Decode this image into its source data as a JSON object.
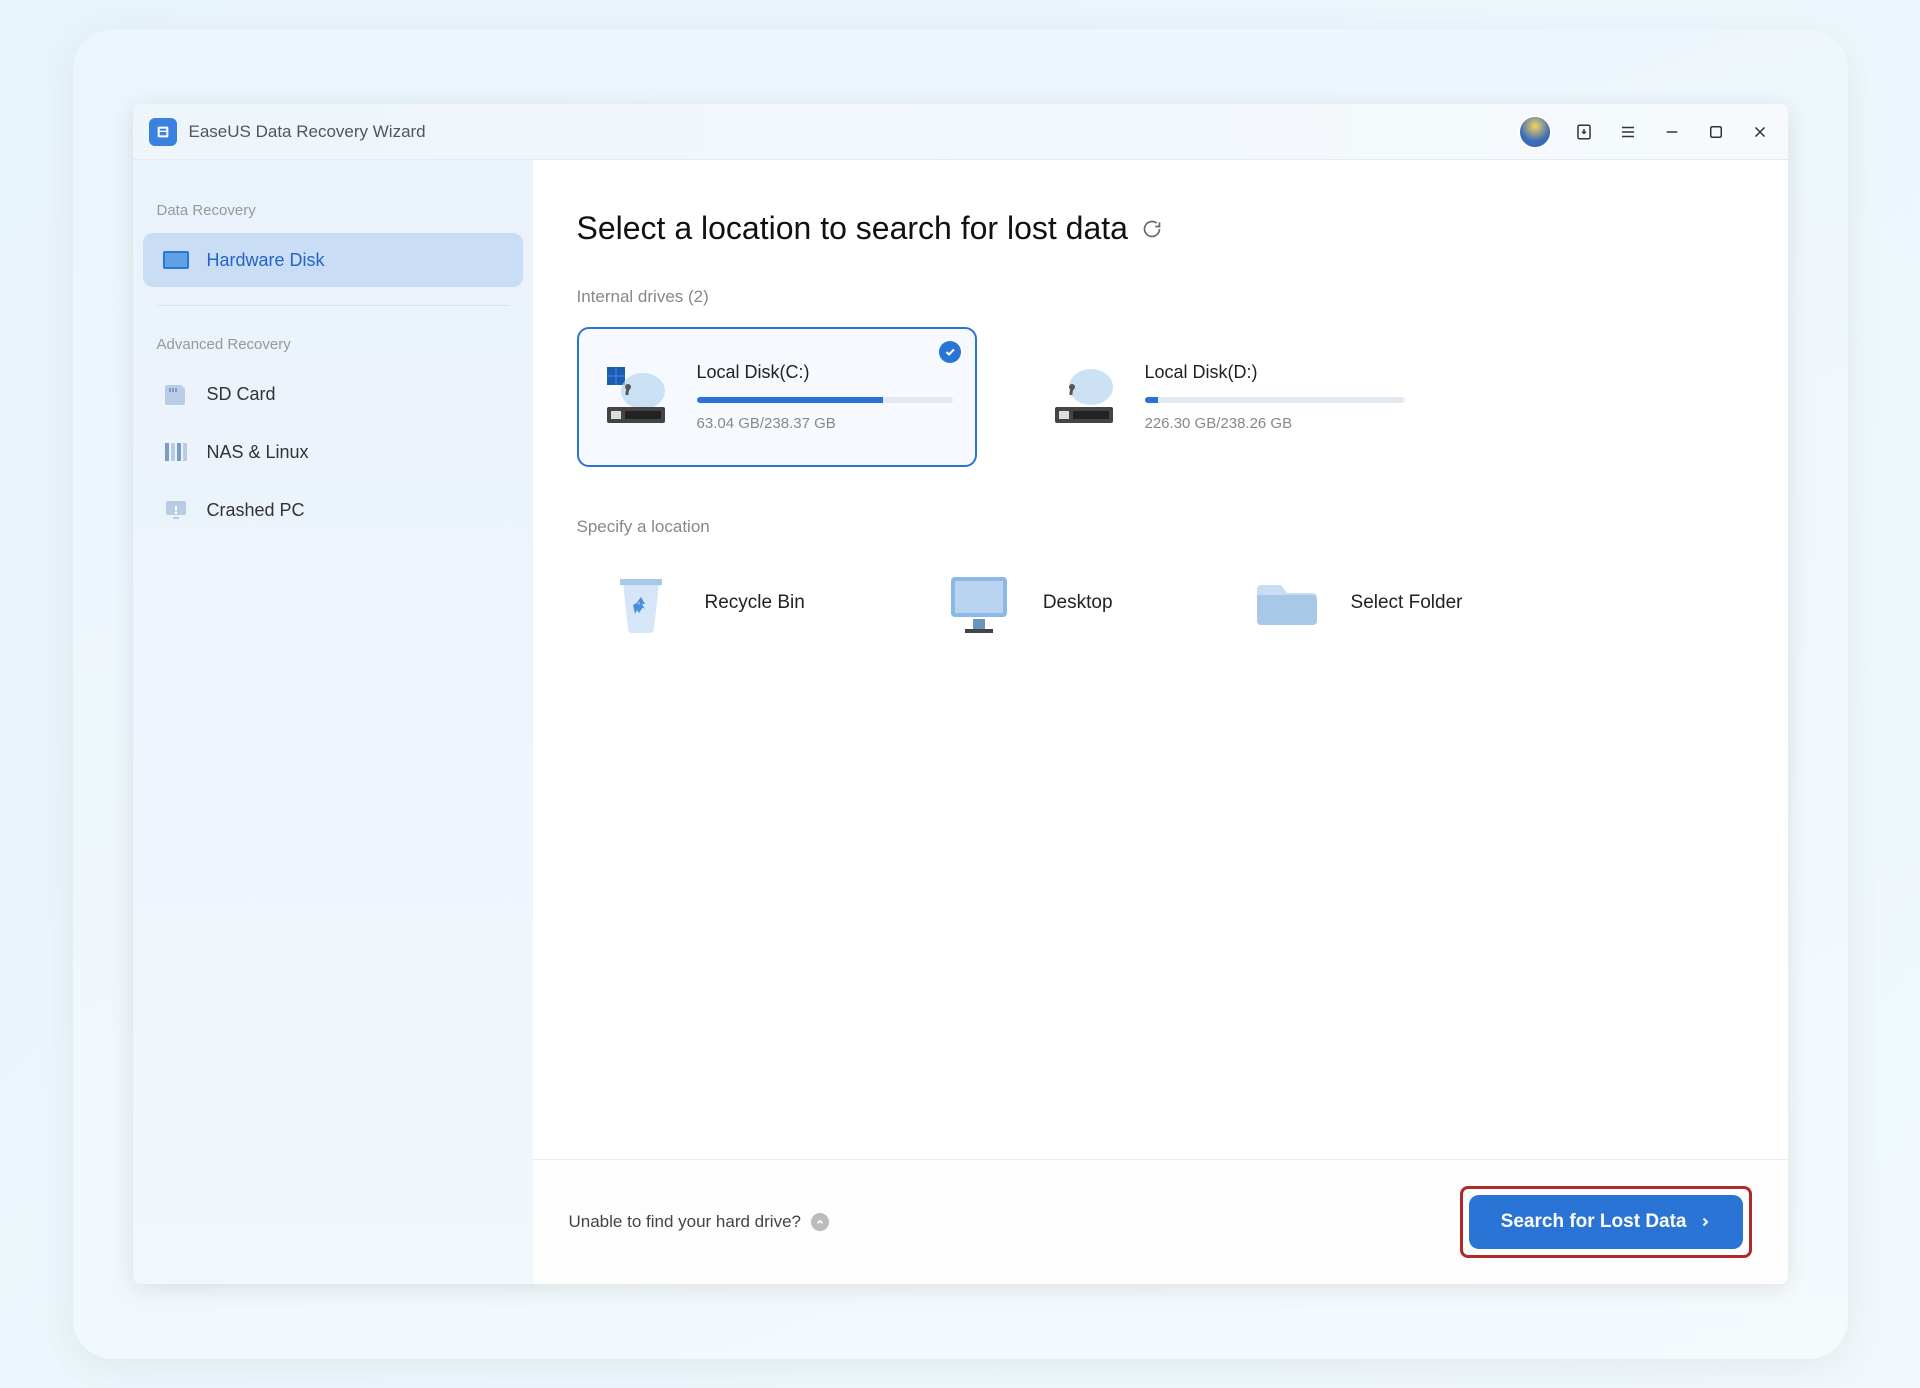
{
  "app": {
    "title": "EaseUS Data Recovery Wizard"
  },
  "sidebar": {
    "section1_title": "Data Recovery",
    "section2_title": "Advanced Recovery",
    "items": [
      {
        "label": "Hardware Disk"
      },
      {
        "label": "SD Card"
      },
      {
        "label": "NAS & Linux"
      },
      {
        "label": "Crashed PC"
      }
    ]
  },
  "page": {
    "title": "Select a location to search for lost data",
    "internal_drives_label": "Internal drives (2)",
    "specify_location_label": "Specify a location",
    "drives": [
      {
        "name": "Local Disk(C:)",
        "usage": "63.04 GB/238.37 GB",
        "fill_pct": 73
      },
      {
        "name": "Local Disk(D:)",
        "usage": "226.30 GB/238.26 GB",
        "fill_pct": 5
      }
    ],
    "locations": [
      {
        "label": "Recycle Bin"
      },
      {
        "label": "Desktop"
      },
      {
        "label": "Select Folder"
      }
    ]
  },
  "footer": {
    "help_text": "Unable to find your hard drive?",
    "search_button": "Search for Lost Data"
  }
}
